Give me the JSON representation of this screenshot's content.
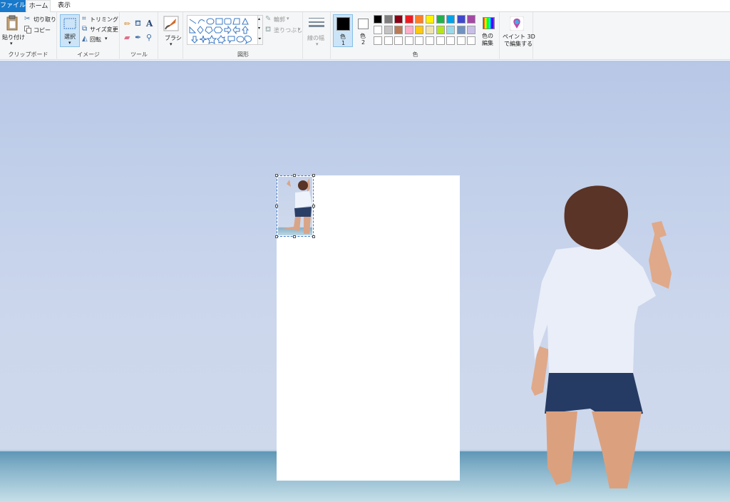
{
  "tabs": {
    "file": "ファイル",
    "home": "ホーム",
    "view": "表示"
  },
  "clipboard": {
    "paste": "貼り付け",
    "cut": "切り取り",
    "copy": "コピー",
    "label": "クリップボード"
  },
  "image": {
    "select": "選択",
    "crop": "トリミング",
    "resize": "サイズ変更",
    "rotate": "回転",
    "label": "イメージ"
  },
  "tools": {
    "label": "ツール"
  },
  "brushes": {
    "label": "ブラシ"
  },
  "shapes": {
    "outline": "輪郭",
    "fill": "塗りつぶし",
    "label": "図形"
  },
  "size": {
    "label": "線の幅"
  },
  "colors": {
    "color1_label": "色",
    "color1_num": "1",
    "color2_label": "色",
    "color2_num": "2",
    "edit_label_1": "色の",
    "edit_label_2": "編集",
    "group_label": "色",
    "palette_row1": [
      "#000000",
      "#7f7f7f",
      "#880015",
      "#ed1c24",
      "#ff7f27",
      "#fff200",
      "#22b14c",
      "#00a2e8",
      "#3f48cc",
      "#a349a4"
    ],
    "palette_row2": [
      "#ffffff",
      "#c3c3c3",
      "#b97a57",
      "#ffaec9",
      "#ffc90e",
      "#efe4b0",
      "#b5e61d",
      "#99d9ea",
      "#7092be",
      "#c8bfe7"
    ],
    "palette_row3": [
      "#ffffff",
      "#ffffff",
      "#ffffff",
      "#ffffff",
      "#ffffff",
      "#ffffff",
      "#ffffff",
      "#ffffff",
      "#ffffff",
      "#ffffff"
    ]
  },
  "paint3d": {
    "line1": "ペイント 3D",
    "line2": "で編集する"
  }
}
